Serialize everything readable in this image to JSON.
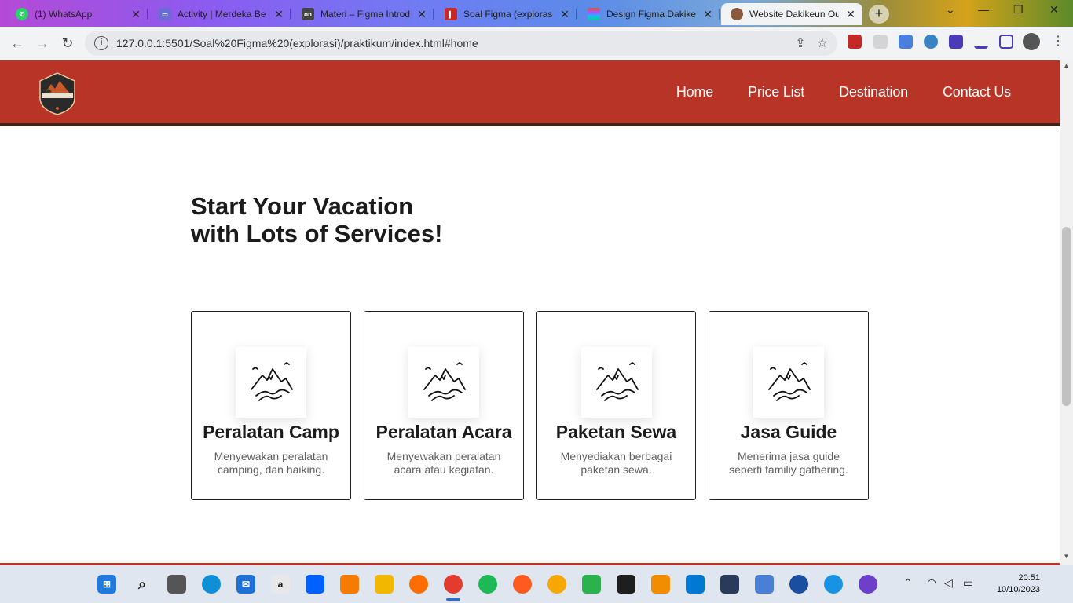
{
  "browser": {
    "tabs": [
      {
        "title": "(1) WhatsApp",
        "favicon_color": "#25d366"
      },
      {
        "title": "Activity | Merdeka Be",
        "favicon_color": "#6b6bd6"
      },
      {
        "title": "Materi – Figma Introd",
        "favicon_color": "#444444"
      },
      {
        "title": "Soal Figma (explorasi",
        "favicon_color": "#c62828"
      },
      {
        "title": "Design Figma Dakike",
        "favicon_color": "#a259ff"
      },
      {
        "title": "Website Dakikeun Ou",
        "favicon_color": "#8a5a3c"
      }
    ],
    "active_tab_index": 5,
    "url": "127.0.0.1:5501/Soal%20Figma%20(explorasi)/praktikum/index.html#home"
  },
  "site": {
    "logo_text": "DAKIKEUN",
    "nav": [
      {
        "label": "Home"
      },
      {
        "label": "Price List"
      },
      {
        "label": "Destination"
      },
      {
        "label": "Contact Us"
      }
    ],
    "heading_line1": "Start Your Vacation",
    "heading_line2": "with Lots of Services!",
    "services": [
      {
        "title": "Peralatan Camp",
        "desc": "Menyewakan peralatan camping, dan haiking.",
        "icon": "mountain-icon"
      },
      {
        "title": "Peralatan Acara",
        "desc": "Menyewakan peralatan acara atau kegiatan.",
        "icon": "mountain-icon"
      },
      {
        "title": "Paketan Sewa",
        "desc": "Menyediakan berbagai paketan sewa.",
        "icon": "mountain-icon"
      },
      {
        "title": "Jasa Guide",
        "desc": "Menerima jasa guide seperti familiy gathering.",
        "icon": "mountain-icon"
      }
    ],
    "colors": {
      "nav_bg": "#b83427",
      "text": "#1b1b1b",
      "desc": "#5e5e5e"
    }
  },
  "taskbar": {
    "time": "20:51",
    "date": "10/10/2023"
  }
}
